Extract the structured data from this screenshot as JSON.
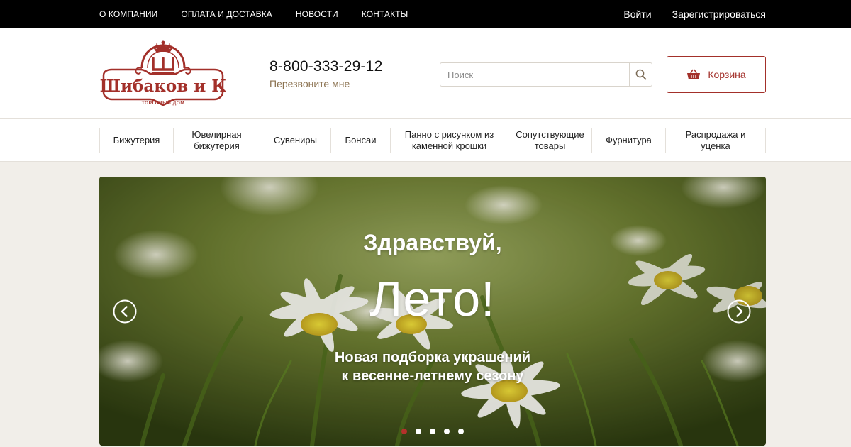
{
  "topbar": {
    "links": [
      "О КОМПАНИИ",
      "ОПЛАТА И ДОСТАВКА",
      "НОВОСТИ",
      "КОНТАКТЫ"
    ],
    "login": "Войти",
    "register": "Зарегистрироваться"
  },
  "header": {
    "logo": {
      "name": "Шибаков и К",
      "tagline": "ТОРГОВЫЙ ДОМ"
    },
    "phone": "8-800-333-29-12",
    "callback": "Перезвоните мне",
    "search_placeholder": "Поиск",
    "cart_label": "Корзина"
  },
  "categories": [
    {
      "label": "Бижутерия"
    },
    {
      "label": "Ювелирная бижутерия"
    },
    {
      "label": "Сувениры"
    },
    {
      "label": "Бонсаи"
    },
    {
      "label": "Панно с рисунком из каменной крошки"
    },
    {
      "label": "Сопутствующие товары"
    },
    {
      "label": "Фурнитура"
    },
    {
      "label": "Распродажа и уценка"
    }
  ],
  "hero": {
    "line1": "Здравствуй,",
    "line2": "Лето!",
    "line3a": "Новая подборка украшений",
    "line3b": "к весенне-летнему сезону",
    "slides_total": 5,
    "active_slide": 1
  },
  "colors": {
    "brand": "#a3302a",
    "accent_text": "#8b7250",
    "topbar_bg": "#000000",
    "page_bg": "#f1eee9"
  },
  "icons": {
    "search": "search-icon",
    "cart": "basket-icon",
    "prev": "chevron-left-icon",
    "next": "chevron-right-icon"
  }
}
